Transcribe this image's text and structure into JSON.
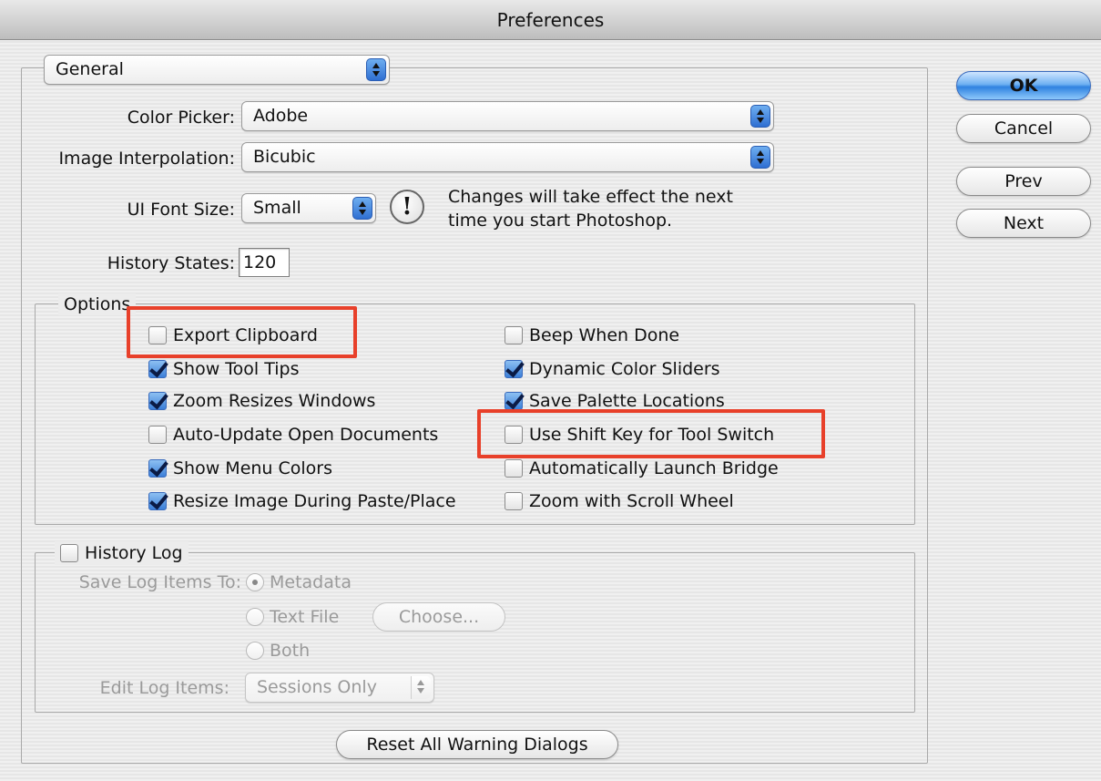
{
  "window": {
    "title": "Preferences"
  },
  "section_popup": {
    "value": "General"
  },
  "general": {
    "color_picker": {
      "label": "Color Picker:",
      "value": "Adobe"
    },
    "image_interpolation": {
      "label": "Image Interpolation:",
      "value": "Bicubic"
    },
    "ui_font_size": {
      "label": "UI Font Size:",
      "value": "Small"
    },
    "font_note": {
      "line1": "Changes will take effect the next",
      "line2": "time you start Photoshop.",
      "icon": "exclamation-icon"
    },
    "history_states": {
      "label": "History States:",
      "value": "120"
    }
  },
  "options": {
    "title": "Options",
    "left": [
      {
        "label": "Export Clipboard",
        "checked": false,
        "highlighted": true
      },
      {
        "label": "Show Tool Tips",
        "checked": true
      },
      {
        "label": "Zoom Resizes Windows",
        "checked": true
      },
      {
        "label": "Auto-Update Open Documents",
        "checked": false
      },
      {
        "label": "Show Menu Colors",
        "checked": true
      },
      {
        "label": "Resize Image During Paste/Place",
        "checked": true
      }
    ],
    "right": [
      {
        "label": "Beep When Done",
        "checked": false
      },
      {
        "label": "Dynamic Color Sliders",
        "checked": true
      },
      {
        "label": "Save Palette Locations",
        "checked": true
      },
      {
        "label": "Use Shift Key for Tool Switch",
        "checked": false,
        "highlighted": true
      },
      {
        "label": "Automatically Launch Bridge",
        "checked": false
      },
      {
        "label": "Zoom with Scroll Wheel",
        "checked": false
      }
    ]
  },
  "history_log": {
    "title": "History Log",
    "checked": false,
    "save_to_label": "Save Log Items To:",
    "radios": [
      {
        "label": "Metadata",
        "selected": true
      },
      {
        "label": "Text File",
        "selected": false
      },
      {
        "label": "Both",
        "selected": false
      }
    ],
    "choose_button": "Choose...",
    "edit_label": "Edit Log Items:",
    "edit_value": "Sessions Only"
  },
  "buttons": {
    "ok": "OK",
    "cancel": "Cancel",
    "prev": "Prev",
    "next": "Next",
    "reset": "Reset All Warning Dialogs"
  },
  "colors": {
    "highlight": "#e8402a",
    "accent": "#2f82e0"
  }
}
